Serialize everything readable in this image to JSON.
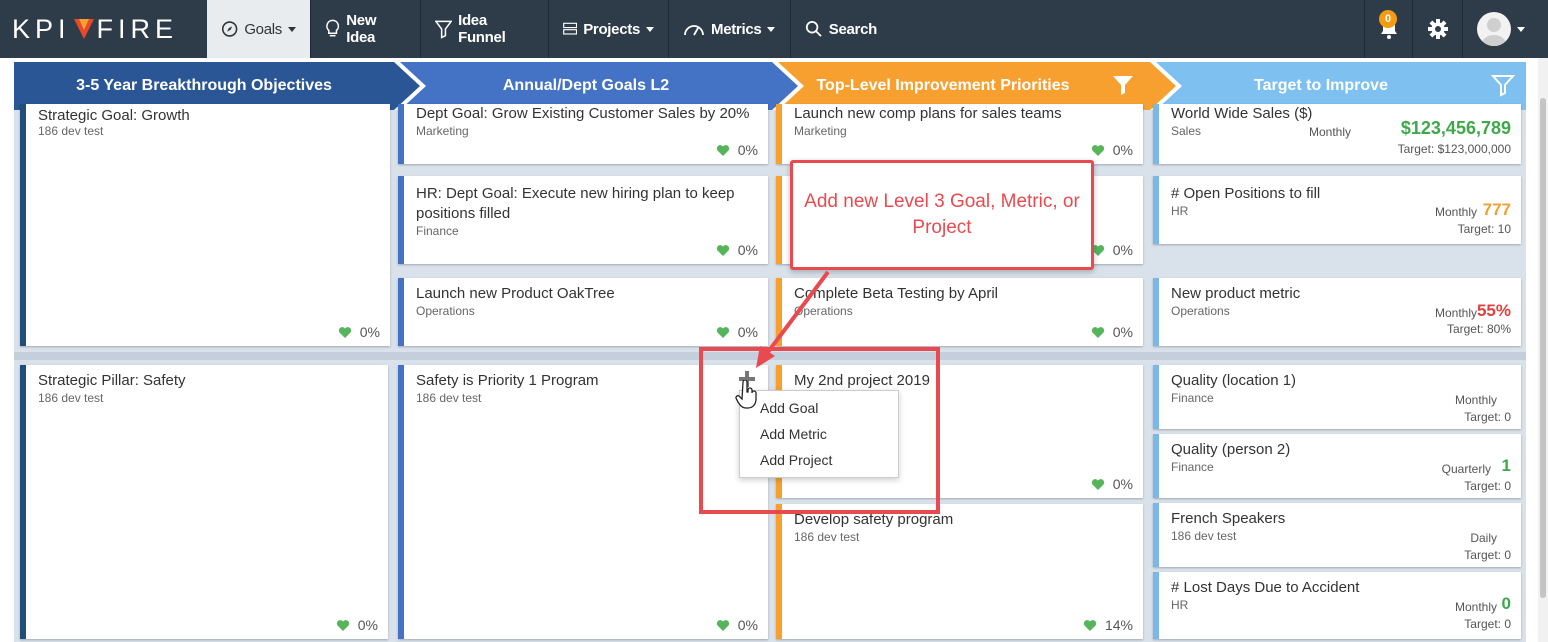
{
  "nav": {
    "logo": "KPI FIRE",
    "items": [
      {
        "label": "Goals"
      },
      {
        "label": "New Idea"
      },
      {
        "label": "Idea Funnel"
      },
      {
        "label": "Projects"
      },
      {
        "label": "Metrics"
      },
      {
        "label": "Search"
      }
    ],
    "notification_count": "0"
  },
  "headers": [
    {
      "label": "3-5 Year Breakthrough Objectives",
      "color": "#2a5696"
    },
    {
      "label": "Annual/Dept Goals L2",
      "color": "#4472c4"
    },
    {
      "label": "Top-Level Improvement Priorities",
      "color": "#f7a030"
    },
    {
      "label": "Target to Improve",
      "color": "#7ec0f0"
    }
  ],
  "row1": {
    "objective": {
      "title": "Strategic Goal: Growth",
      "sub": "186 dev test",
      "pct": "0%"
    },
    "goals": [
      {
        "title": "Dept Goal: Grow Existing Customer Sales by 20%",
        "sub": "Marketing",
        "pct": "0%"
      },
      {
        "title": "HR: Dept Goal: Execute new hiring plan to keep positions filled",
        "sub": "Finance",
        "pct": "0%"
      },
      {
        "title": "Launch new Product OakTree",
        "sub": "Operations",
        "pct": "0%"
      }
    ],
    "priorities": [
      {
        "title": "Launch new comp plans for sales teams",
        "sub": "Marketing",
        "pct": "0%"
      },
      {
        "title": "",
        "sub": "",
        "pct": "0%"
      },
      {
        "title": "Complete Beta Testing by April",
        "sub": "Operations",
        "pct": "0%"
      }
    ],
    "metrics": [
      {
        "title": "World Wide Sales ($)",
        "sub": "Sales",
        "freq": "Monthly",
        "value": "$123,456,789",
        "value_color": "#3ea94b",
        "target": "Target: $123,000,000"
      },
      {
        "title": "# Open Positions to fill",
        "sub": "HR",
        "freq": "Monthly",
        "value": "777",
        "value_color": "#f0a030",
        "target": "Target: 10"
      },
      {
        "title": "New product metric",
        "sub": "Operations",
        "freq": "Monthly",
        "value": "55%",
        "value_color": "#e04040",
        "target": "Target: 80%"
      }
    ]
  },
  "row2": {
    "objective": {
      "title": "Strategic Pillar: Safety",
      "sub": "186 dev test",
      "pct": "0%"
    },
    "goal": {
      "title": "Safety is Priority 1 Program",
      "sub": "186 dev test",
      "pct": "0%"
    },
    "priorities": [
      {
        "title": "My 2nd project 2019",
        "sub": "",
        "pct": "0%"
      },
      {
        "title": "Develop safety program",
        "sub": "186 dev test",
        "pct": "14%"
      }
    ],
    "metrics": [
      {
        "title": "Quality (location 1)",
        "sub": "Finance",
        "freq": "Monthly",
        "value": "",
        "value_color": "#3ea94b",
        "target": "Target: 0"
      },
      {
        "title": "Quality (person 2)",
        "sub": "Finance",
        "freq": "Quarterly",
        "value": "1",
        "value_color": "#3ea94b",
        "target": "Target: 0"
      },
      {
        "title": "French Speakers",
        "sub": "186 dev test",
        "freq": "Daily",
        "value": "",
        "value_color": "#3ea94b",
        "target": "Target: 0"
      },
      {
        "title": "# Lost Days Due to Accident",
        "sub": "HR",
        "freq": "Monthly",
        "value": "0",
        "value_color": "#3ea94b",
        "target": "Target: 0"
      }
    ]
  },
  "add_menu": {
    "items": [
      "Add Goal",
      "Add Metric",
      "Add Project"
    ]
  },
  "callout": {
    "text": "Add new Level 3 Goal, Metric, or Project"
  }
}
